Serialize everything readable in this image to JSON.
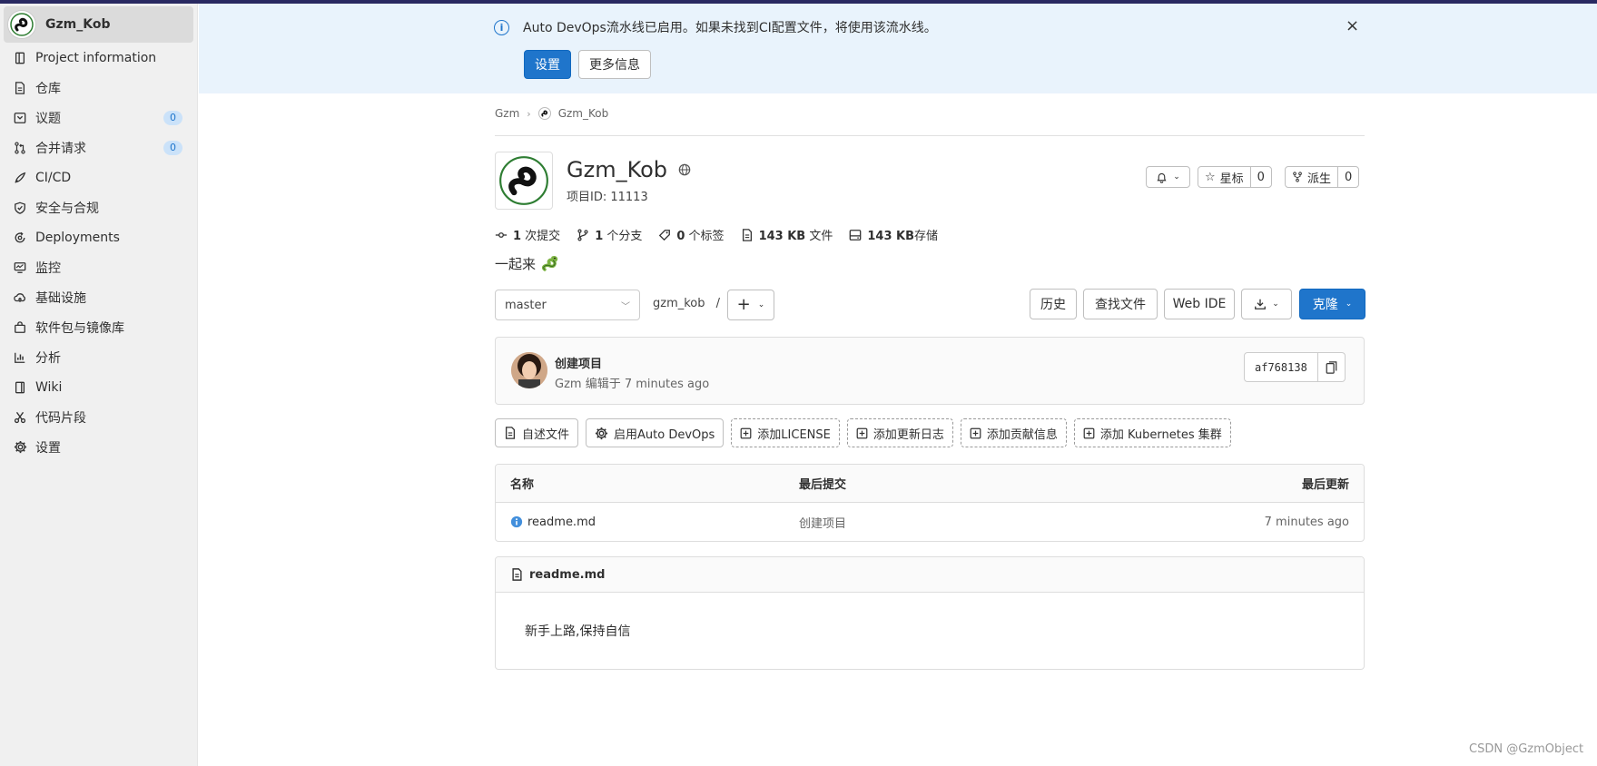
{
  "sidebar": {
    "project_name": "Gzm_Kob",
    "items": [
      {
        "label": "Project information",
        "icon": "document-icon",
        "badge": ""
      },
      {
        "label": "仓库",
        "icon": "file-icon",
        "badge": ""
      },
      {
        "label": "议题",
        "icon": "issues-icon",
        "badge": "0"
      },
      {
        "label": "合并请求",
        "icon": "merge-request-icon",
        "badge": "0"
      },
      {
        "label": "CI/CD",
        "icon": "rocket-icon",
        "badge": ""
      },
      {
        "label": "安全与合规",
        "icon": "shield-icon",
        "badge": ""
      },
      {
        "label": "Deployments",
        "icon": "deployments-icon",
        "badge": ""
      },
      {
        "label": "监控",
        "icon": "monitor-icon",
        "badge": ""
      },
      {
        "label": "基础设施",
        "icon": "cloud-icon",
        "badge": ""
      },
      {
        "label": "软件包与镜像库",
        "icon": "package-icon",
        "badge": ""
      },
      {
        "label": "分析",
        "icon": "chart-icon",
        "badge": ""
      },
      {
        "label": "Wiki",
        "icon": "book-icon",
        "badge": ""
      },
      {
        "label": "代码片段",
        "icon": "scissors-icon",
        "badge": ""
      },
      {
        "label": "设置",
        "icon": "gear-icon",
        "badge": ""
      }
    ]
  },
  "alert": {
    "text": "Auto DevOps流水线已启用。如果未找到CI配置文件，将使用该流水线。",
    "primary_label": "设置",
    "secondary_label": "更多信息",
    "close": "×"
  },
  "breadcrumb": {
    "group": "Gzm",
    "project": "Gzm_Kob"
  },
  "project": {
    "name": "Gzm_Kob",
    "id_text": "项目ID: 11113",
    "star_label": "星标",
    "star_count": "0",
    "fork_label": "派生",
    "fork_count": "0",
    "description": "一起来"
  },
  "stats": [
    {
      "icon": "commit-icon",
      "value": "1",
      "label": " 次提交"
    },
    {
      "icon": "branch-icon",
      "value": "1",
      "label": " 个分支"
    },
    {
      "icon": "tag-icon",
      "value": "0",
      "label": " 个标签"
    },
    {
      "icon": "file-icon",
      "value": "143 KB",
      "label": " 文件"
    },
    {
      "icon": "disk-icon",
      "value": "143 KB",
      "label": "存储"
    }
  ],
  "toolbar": {
    "branch": "master",
    "path": "gzm_kob",
    "path_sep": "/",
    "add": "+",
    "history": "历史",
    "find_file": "查找文件",
    "web_ide": "Web IDE",
    "clone": "克隆"
  },
  "commit": {
    "title": "创建项目",
    "author": "Gzm",
    "meta": " 编辑于 7 minutes ago",
    "sha": "af768138"
  },
  "quick_actions": [
    {
      "label": "自述文件",
      "icon": "file-icon",
      "dashed": false
    },
    {
      "label": "启用Auto DevOps",
      "icon": "gear-icon",
      "dashed": false
    },
    {
      "label": "添加LICENSE",
      "icon": "plus-square-icon",
      "dashed": true
    },
    {
      "label": "添加更新日志",
      "icon": "plus-square-icon",
      "dashed": true
    },
    {
      "label": "添加贡献信息",
      "icon": "plus-square-icon",
      "dashed": true
    },
    {
      "label": "添加 Kubernetes 集群",
      "icon": "plus-square-icon",
      "dashed": true
    }
  ],
  "files": {
    "headers": {
      "name": "名称",
      "last_commit": "最后提交",
      "last_update": "最后更新"
    },
    "rows": [
      {
        "name": "readme.md",
        "last_commit": "创建项目",
        "last_update": "7 minutes ago"
      }
    ]
  },
  "readme": {
    "filename": "readme.md",
    "content": "新手上路,保持自信"
  },
  "watermark": "CSDN @GzmObject",
  "colors": {
    "accent": "#1f75cb",
    "alert_bg": "#e9f3fc",
    "sidebar_bg": "#f0f0f0",
    "topbar": "#292961"
  }
}
